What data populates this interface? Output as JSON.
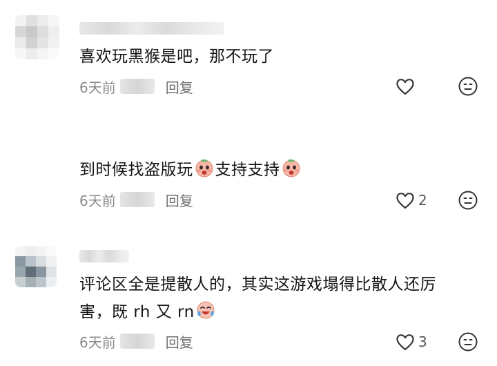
{
  "comments": [
    {
      "text": "喜欢玩黑猴是吧，那不玩了",
      "time": "6天前",
      "reply_label": "回复",
      "like_count": ""
    },
    {
      "text": "到时候找盗版玩",
      "text_after_emoji": "支持支持",
      "time": "6天前",
      "reply_label": "回复",
      "like_count": "2"
    },
    {
      "text_line1": "评论区全是提散人的，其实这游戏塌得比散人还厉",
      "text_line2": "害，既 rh 又 rn",
      "time": "6天前",
      "reply_label": "回复",
      "like_count": "3"
    }
  ],
  "icons": {
    "like": "heart-outline-icon",
    "dislike": "meh-face-icon",
    "emoji_a": "crying-pink-face-emoji",
    "emoji_b": "laughing-crying-face-emoji"
  },
  "colors": {
    "text": "#161616",
    "meta": "#8a8a8a",
    "icon": "#333333"
  }
}
